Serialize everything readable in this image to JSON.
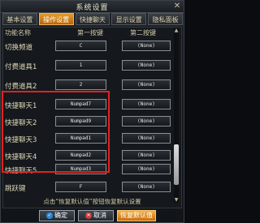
{
  "window": {
    "title": "系统设置",
    "close_glyph": "✕"
  },
  "tabs": [
    {
      "label": "基本设置",
      "active": false
    },
    {
      "label": "操作设置",
      "active": true
    },
    {
      "label": "快捷聊天",
      "active": false
    },
    {
      "label": "显示设置",
      "active": false
    },
    {
      "label": "隐私面板",
      "active": false
    }
  ],
  "columns": {
    "function": "功能名称",
    "key1": "第一按键",
    "key2": "第二按键"
  },
  "rows": [
    {
      "label": "切换频道",
      "key1": "C",
      "key2": "(None)"
    },
    {
      "label": "付费道具1",
      "key1": "1",
      "key2": "(None)"
    },
    {
      "label": "付费道具2",
      "key1": "2",
      "key2": "(None)"
    },
    {
      "label": "快捷聊天1",
      "key1": "Numpad7",
      "key2": "(None)"
    },
    {
      "label": "快捷聊天2",
      "key1": "Numpad9",
      "key2": "(None)"
    },
    {
      "label": "快捷聊天3",
      "key1": "Numpad1",
      "key2": "(None)"
    },
    {
      "label": "快捷聊天4",
      "key1": "Numpad2",
      "key2": "(None)"
    },
    {
      "label": "快捷聊天5",
      "key1": "Numpad3",
      "key2": "(None)"
    },
    {
      "label": "跳跃键",
      "key1": "F",
      "key2": "(None)"
    }
  ],
  "hint": "点击“恢复默认值”按钮恢复默认设置",
  "buttons": {
    "ok": "确定",
    "cancel": "取消",
    "restore": "恢复默认值"
  },
  "colors": {
    "accent": "#e08d1c",
    "highlight": "#e32121"
  }
}
